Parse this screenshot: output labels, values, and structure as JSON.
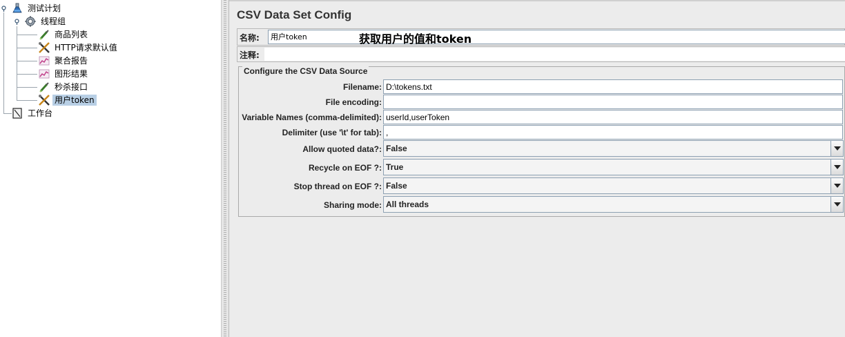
{
  "tree": {
    "root": "测试计划",
    "thread_group": "线程组",
    "children": [
      "商品列表",
      "HTTP请求默认值",
      "聚合报告",
      "图形结果",
      "秒杀接口",
      "用户token"
    ],
    "workbench": "工作台"
  },
  "config": {
    "title": "CSV Data Set Config",
    "name_label": "名称:",
    "name_value": "用户token",
    "comment_label": "注释:",
    "comment_value": "",
    "annotation": "获取用户的值和token",
    "section_title": "Configure the CSV Data Source",
    "filename_label": "Filename:",
    "filename_value": "D:\\tokens.txt",
    "encoding_label": "File encoding:",
    "encoding_value": "",
    "varnames_label": "Variable Names (comma-delimited):",
    "varnames_value": "userId,userToken",
    "delimiter_label": "Delimiter (use '\\t' for tab):",
    "delimiter_value": ",",
    "quoted_label": "Allow quoted data?:",
    "quoted_value": "False",
    "recycle_label": "Recycle on EOF ?:",
    "recycle_value": "True",
    "stop_label": "Stop thread on EOF ?:",
    "stop_value": "False",
    "sharing_label": "Sharing mode:",
    "sharing_value": "All threads"
  },
  "colors": {
    "selection": "#b8cfe5",
    "panel_bg": "#ececec",
    "field_border": "#8da0b2"
  }
}
